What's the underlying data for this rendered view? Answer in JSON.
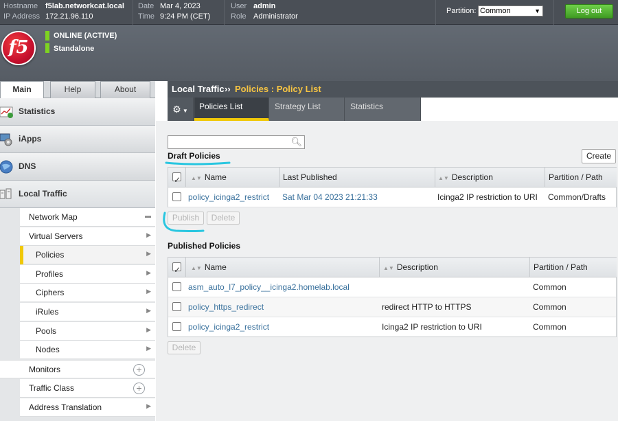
{
  "topbar": {
    "hostname_label": "Hostname",
    "hostname": "f5lab.networkcat.local",
    "ip_label": "IP Address",
    "ip": "172.21.96.110",
    "date_label": "Date",
    "date": "Mar 4, 2023",
    "time_label": "Time",
    "time": "9:24 PM (CET)",
    "user_label": "User",
    "user": "admin",
    "role_label": "Role",
    "role": "Administrator",
    "partition_label": "Partition:",
    "partition_value": "Common",
    "logout_label": "Log out"
  },
  "banner": {
    "logo_text": "f5",
    "status": "ONLINE (ACTIVE)",
    "mode": "Standalone",
    "status_color": "#7ed321"
  },
  "left_tabs": [
    "Main",
    "Help",
    "About"
  ],
  "nav_sections": [
    {
      "label": "Statistics",
      "icon": "statistics-icon"
    },
    {
      "label": "iApps",
      "icon": "iapps-icon"
    },
    {
      "label": "DNS",
      "icon": "dns-globe-icon"
    },
    {
      "label": "Local Traffic",
      "icon": "local-traffic-icon"
    }
  ],
  "nav_subitems": [
    {
      "label": "Network Map",
      "indent": false
    },
    {
      "label": "Virtual Servers",
      "indent": false
    },
    {
      "label": "Policies",
      "indent": true
    },
    {
      "label": "Profiles",
      "indent": true
    },
    {
      "label": "Ciphers",
      "indent": true
    },
    {
      "label": "iRules",
      "indent": true
    },
    {
      "label": "Pools",
      "indent": true
    },
    {
      "label": "Nodes",
      "indent": true
    },
    {
      "label": "Monitors",
      "indent": false
    },
    {
      "label": "Traffic Class",
      "indent": false
    },
    {
      "label": "Address Translation",
      "indent": false
    }
  ],
  "breadcrumb": {
    "section": "Local Traffic",
    "separator": "››",
    "page": "Policies : Policy List"
  },
  "subtabs": [
    "Policies List",
    "Strategy List",
    "Statistics"
  ],
  "accent_color": "#f0c808",
  "search": {
    "value": ""
  },
  "draft": {
    "title": "Draft Policies",
    "create_label": "Create",
    "columns": [
      "Name",
      "Last Published",
      "Description",
      "Partition / Path"
    ],
    "rows": [
      {
        "name": "policy_icinga2_restrict",
        "last_published": "Sat Mar 04 2023 21:21:33",
        "description": "Icinga2 IP restriction to URI",
        "partition": "Common/Drafts"
      }
    ],
    "publish_label": "Publish",
    "delete_label": "Delete"
  },
  "published": {
    "title": "Published Policies",
    "columns": [
      "Name",
      "Description",
      "Partition / Path"
    ],
    "rows": [
      {
        "name": "asm_auto_l7_policy__icinga2.homelab.local",
        "description": "",
        "partition": "Common"
      },
      {
        "name": "policy_https_redirect",
        "description": "redirect HTTP to HTTPS",
        "partition": "Common"
      },
      {
        "name": "policy_icinga2_restrict",
        "description": "Icinga2 IP restriction to URI",
        "partition": "Common"
      }
    ],
    "delete_label": "Delete"
  },
  "annotation_color": "#29c6e0"
}
